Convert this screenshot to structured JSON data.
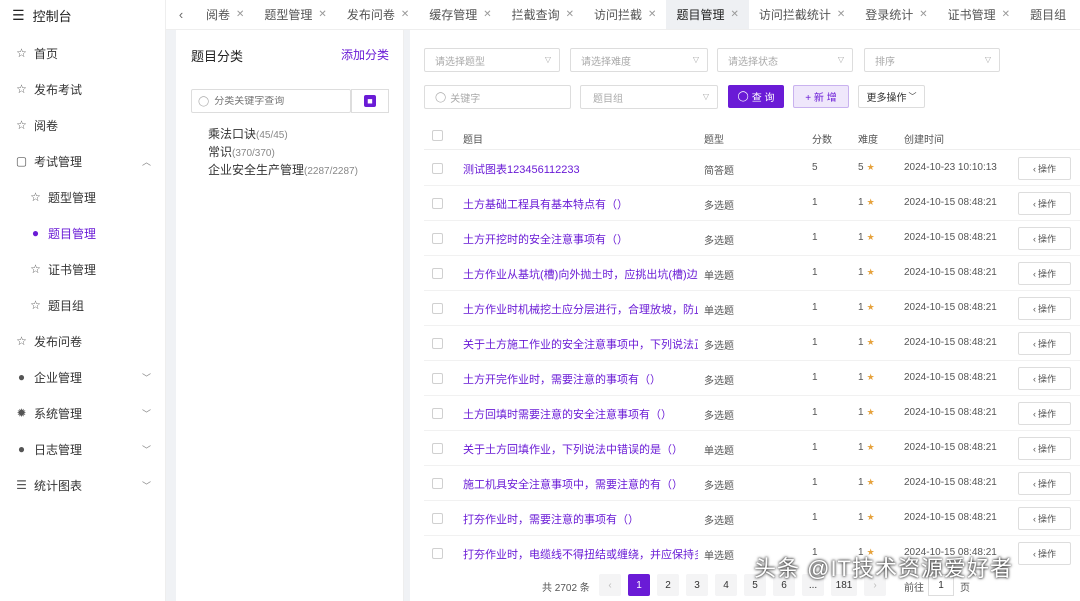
{
  "sidebar": {
    "header": "控制台",
    "items": [
      {
        "label": "首页"
      },
      {
        "label": "发布考试"
      },
      {
        "label": "阅卷"
      },
      {
        "label": "考试管理"
      },
      {
        "label": "题型管理"
      },
      {
        "label": "题目管理"
      },
      {
        "label": "证书管理"
      },
      {
        "label": "题目组"
      },
      {
        "label": "发布问卷"
      },
      {
        "label": "企业管理"
      },
      {
        "label": "系统管理"
      },
      {
        "label": "日志管理"
      },
      {
        "label": "统计图表"
      }
    ]
  },
  "tabs": [
    "阅卷",
    "题型管理",
    "发布问卷",
    "缓存管理",
    "拦截查询",
    "访问拦截",
    "题目管理",
    "访问拦截统计",
    "登录统计",
    "证书管理",
    "题目组"
  ],
  "category": {
    "title": "题目分类",
    "add_label": "添加分类",
    "search_placeholder": "分类关键字查询",
    "tree": [
      {
        "name": "乘法口诀",
        "count": "(45/45)"
      },
      {
        "name": "常识",
        "count": "(370/370)"
      },
      {
        "name": "企业安全生产管理",
        "count": "(2287/2287)"
      }
    ]
  },
  "filters": {
    "type_placeholder": "请选择题型",
    "difficulty_placeholder": "请选择难度",
    "status_placeholder": "请选择状态",
    "sort_placeholder": "排序",
    "keyword_placeholder": "关键字",
    "group_placeholder": "题目组",
    "query_label": "查 询",
    "add_label": "+ 新 增",
    "more_label": "更多操作"
  },
  "table": {
    "headers": {
      "title": "题目",
      "type": "题型",
      "score": "分数",
      "difficulty": "难度",
      "time": "创建时间"
    },
    "op_label": "操作",
    "rows": [
      {
        "title": "测试图表123456112233",
        "type": "简答题",
        "score": "5",
        "difficulty": "5",
        "time": "2024-10-23 10:10:13"
      },
      {
        "title": "土方基础工程具有基本特点有（）",
        "type": "多选题",
        "score": "1",
        "difficulty": "1",
        "time": "2024-10-15 08:48:21"
      },
      {
        "title": "土方开挖时的安全注意事项有（）",
        "type": "多选题",
        "score": "1",
        "difficulty": "1",
        "time": "2024-10-15 08:48:21"
      },
      {
        "title": "土方作业从基坑(槽)向外抛土时，应挑出坑(槽)边沿",
        "type": "单选题",
        "score": "1",
        "difficulty": "1",
        "time": "2024-10-15 08:48:21"
      },
      {
        "title": "土方作业时机械挖土应分层进行，合理放坡，防止坍",
        "type": "单选题",
        "score": "1",
        "difficulty": "1",
        "time": "2024-10-15 08:48:21"
      },
      {
        "title": "关于土方施工作业的安全注意事项中，下列说法正确",
        "type": "多选题",
        "score": "1",
        "difficulty": "1",
        "time": "2024-10-15 08:48:21"
      },
      {
        "title": "土方开完作业时，需要注意的事项有（）",
        "type": "多选题",
        "score": "1",
        "difficulty": "1",
        "time": "2024-10-15 08:48:21"
      },
      {
        "title": "土方回填时需要注意的安全注意事项有（）",
        "type": "多选题",
        "score": "1",
        "difficulty": "1",
        "time": "2024-10-15 08:48:21"
      },
      {
        "title": "关于土方回填作业，下列说法中错误的是（）",
        "type": "单选题",
        "score": "1",
        "difficulty": "1",
        "time": "2024-10-15 08:48:21"
      },
      {
        "title": "施工机具安全注意事项中，需要注意的有（）",
        "type": "多选题",
        "score": "1",
        "difficulty": "1",
        "time": "2024-10-15 08:48:21"
      },
      {
        "title": "打夯作业时，需要注意的事项有（）",
        "type": "多选题",
        "score": "1",
        "difficulty": "1",
        "time": "2024-10-15 08:48:21"
      },
      {
        "title": "打夯作业时，电缆线不得扭结或缠绕，并应保持多余",
        "type": "单选题",
        "score": "1",
        "difficulty": "1",
        "time": "2024-10-15 08:48:21"
      }
    ]
  },
  "pagination": {
    "total": "共 2702 条",
    "pages": [
      "1",
      "2",
      "3",
      "4",
      "5",
      "6",
      "...",
      "181"
    ],
    "goto_label": "前往",
    "current": "1",
    "unit": "页"
  },
  "watermark": "头条 @IT技术资源爱好者",
  "colors": {
    "accent": "#6a1bd6",
    "star": "#e6a23c"
  }
}
